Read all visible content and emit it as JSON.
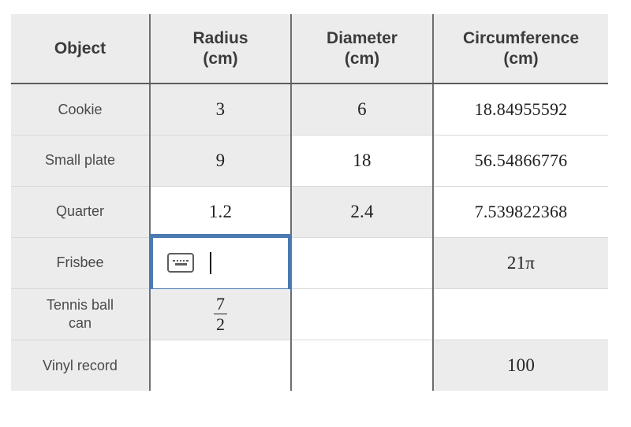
{
  "table": {
    "columns": [
      {
        "id": "object",
        "line1": "Object",
        "line2": ""
      },
      {
        "id": "radius",
        "line1": "Radius",
        "line2": "(cm)"
      },
      {
        "id": "diameter",
        "line1": "Diameter",
        "line2": "(cm)"
      },
      {
        "id": "circumference",
        "line1": "Circumference",
        "line2": "(cm)"
      }
    ],
    "rows": [
      {
        "object_line1": "Cookie",
        "object_line2": "",
        "radius": "3",
        "diameter": "6",
        "circumference": "18.84955592",
        "radius_state": "filled",
        "diameter_state": "filled",
        "circumference_state": "blank"
      },
      {
        "object_line1": "Small plate",
        "object_line2": "",
        "radius": "9",
        "diameter": "18",
        "circumference": "56.54866776",
        "radius_state": "filled",
        "diameter_state": "blank",
        "circumference_state": "blank"
      },
      {
        "object_line1": "Quarter",
        "object_line2": "",
        "radius": "1.2",
        "diameter": "2.4",
        "circumference": "7.539822368",
        "radius_state": "blank",
        "diameter_state": "filled",
        "circumference_state": "blank"
      },
      {
        "object_line1": "Frisbee",
        "object_line2": "",
        "radius": "",
        "diameter": "",
        "circumference": "21π",
        "radius_state": "focused-input",
        "diameter_state": "blank",
        "circumference_state": "filled"
      },
      {
        "object_line1": "Tennis ball",
        "object_line2": "can",
        "radius": "7/2",
        "radius_numerator": "7",
        "radius_denominator": "2",
        "diameter": "",
        "circumference": "",
        "radius_state": "fraction",
        "diameter_state": "blank",
        "circumference_state": "blank"
      },
      {
        "object_line1": "Vinyl record",
        "object_line2": "",
        "radius": "",
        "diameter": "",
        "circumference": "100",
        "radius_state": "blank",
        "diameter_state": "blank",
        "circumference_state": "filled"
      }
    ]
  },
  "active_input": {
    "row": "Frisbee",
    "column": "Radius (cm)",
    "value": "",
    "keyboard_icon": "keyboard-icon",
    "caret_visible": true,
    "focus_color": "#4a7ab0"
  },
  "colors": {
    "filled_cell": "#ececec",
    "blank_cell": "#ffffff",
    "header_bg": "#ececec",
    "column_border": "#6e6e6e",
    "row_border": "#d8d8d8",
    "focus_border": "#4a7ab0",
    "header_text": "#3b3b3b",
    "value_text": "#222222",
    "object_text": "#4a4a4a"
  }
}
